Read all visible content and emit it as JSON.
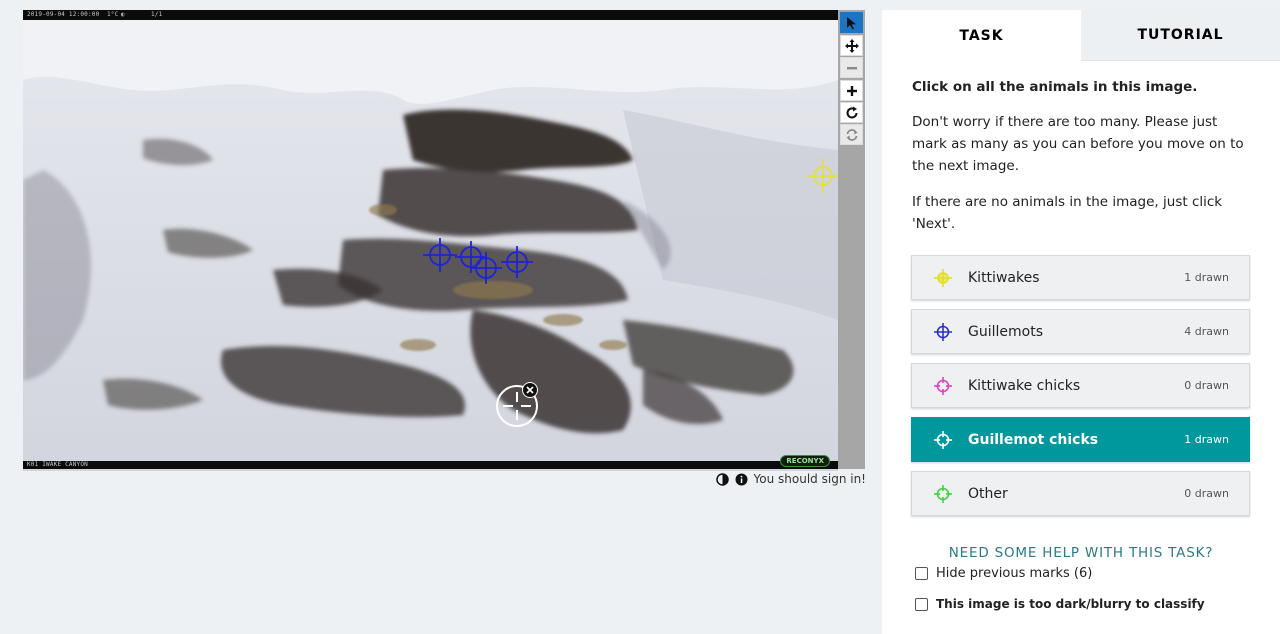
{
  "viewer": {
    "info_left": "2019-09-04 12:00:00",
    "info_temp": "1°C",
    "info_moon": "◐",
    "info_count": "1/1",
    "bottom_label": "K01 IWAKE CANYON",
    "watermark": "RECONYX",
    "toolbar": [
      {
        "name": "pointer-tool",
        "icon": "arrow-pointer-icon",
        "state": "active"
      },
      {
        "name": "pan-tool",
        "icon": "move-arrows-icon",
        "state": "normal"
      },
      {
        "name": "zoom-out-tool",
        "icon": "minus-icon",
        "state": "disabled"
      },
      {
        "name": "zoom-in-tool",
        "icon": "plus-icon",
        "state": "normal"
      },
      {
        "name": "rotate-tool",
        "icon": "rotate-icon",
        "state": "normal"
      },
      {
        "name": "reset-tool",
        "icon": "refresh-icon",
        "state": "disabled"
      }
    ],
    "sign_in_text": "You should sign in!"
  },
  "marks": {
    "kittiwake_color": "#e8e21c",
    "guillemot_color": "#1f23d6",
    "guillemot_chick_color": "#ffffff"
  },
  "panel": {
    "tabs": [
      {
        "label": "TASK",
        "active": true
      },
      {
        "label": "TUTORIAL",
        "active": false
      }
    ],
    "question": "Click on all the animals in this image.",
    "help_1": "Don't worry if there are too many. Please just mark as many as you can before you move on to the next image.",
    "help_2": "If there are no animals in the image, just click 'Next'.",
    "tools": [
      {
        "label": "Kittiwakes",
        "count": "1 drawn",
        "color": "#e3df1e",
        "icon": "crosshair-icon",
        "selected": false
      },
      {
        "label": "Guillemots",
        "count": "4 drawn",
        "color": "#2a2fd1",
        "icon": "crosshair-icon",
        "selected": false
      },
      {
        "label": "Kittiwake chicks",
        "count": "0 drawn",
        "color": "#e040c8",
        "icon": "crosshair-icon",
        "selected": false
      },
      {
        "label": "Guillemot chicks",
        "count": "1 drawn",
        "color": "#ffffff",
        "icon": "crosshair-icon",
        "selected": true
      },
      {
        "label": "Other",
        "count": "0 drawn",
        "color": "#3ed33e",
        "icon": "crosshair-icon",
        "selected": false
      }
    ],
    "need_help": "NEED SOME HELP WITH THIS TASK?",
    "hide_marks": "Hide previous marks (6)",
    "too_dark": "This image is too dark/blurry to classify"
  }
}
